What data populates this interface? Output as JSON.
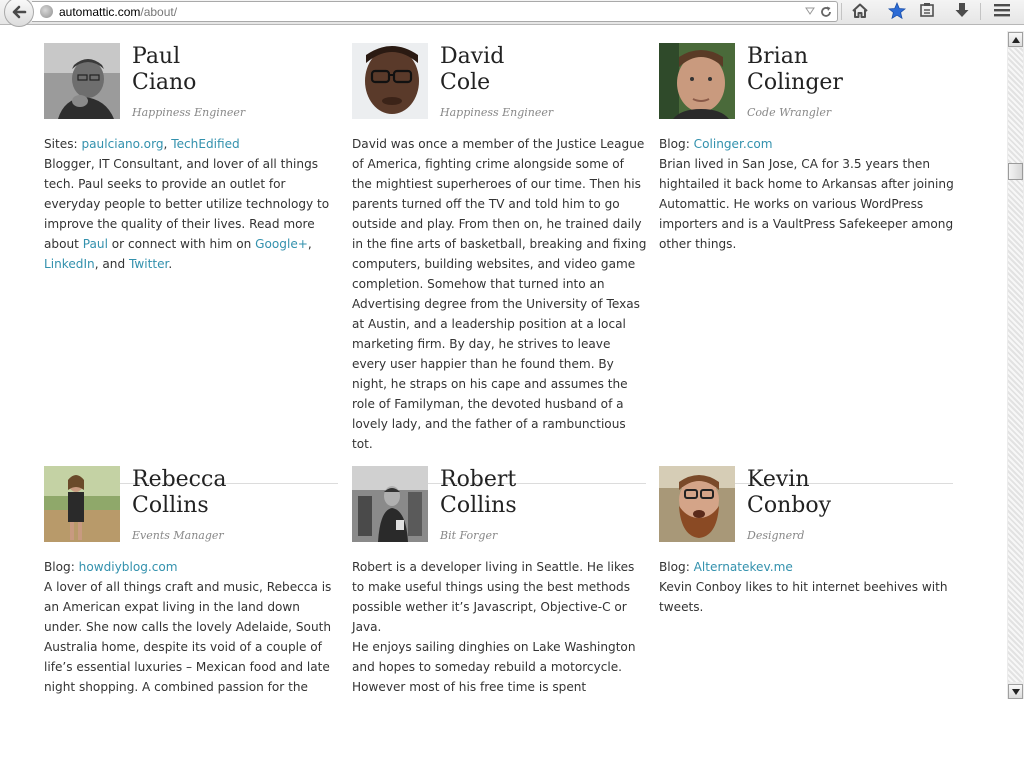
{
  "browser": {
    "url_domain": "automattic.com",
    "url_path": "/about/",
    "toolbar_icons": [
      "home-icon",
      "bookmark-star-icon",
      "clipboard-icon",
      "download-icon",
      "menu-icon"
    ]
  },
  "team": [
    {
      "first": "Paul",
      "last": "Ciano",
      "role": "Happiness Engineer",
      "links_label": "Sites: ",
      "links": [
        "paulciano.org",
        "TechEdified"
      ],
      "bio_pre": "Blogger, IT Consultant, and lover of all things tech. Paul seeks to provide an outlet for everyday people to better utilize technology to improve the quality of their lives. Read more about ",
      "bio_link1": "Paul",
      "bio_mid": " or connect with him on ",
      "bio_link2": "Google+",
      "bio_link3": "LinkedIn",
      "bio_and": ", and ",
      "bio_link4": "Twitter"
    },
    {
      "first": "David",
      "last": "Cole",
      "role": "Happiness Engineer",
      "bio": "David was once a member of the Justice League of America, fighting crime alongside some of the mightiest superheroes of our time. Then his parents turned off the TV and told him to go outside and play. From then on, he trained daily in the fine arts of basketball, breaking and fixing computers, building websites, and video game completion. Somehow that turned into an Advertising degree from the University of Texas at Austin, and a leadership position at a local marketing firm. By day, he strives to leave every user happier than he found them. By night, he straps on his cape and assumes the role of Familyman, the devoted husband of a lovely lady, and the father of a rambunctious tot."
    },
    {
      "first": "Brian",
      "last": "Colinger",
      "role": "Code Wrangler",
      "links_label": "Blog: ",
      "link": "Colinger.com",
      "bio": "Brian lived in San Jose, CA for 3.5 years then hightailed it back home to Arkansas after joining Automattic. He works on various WordPress importers and is a VaultPress Safekeeper among other things."
    },
    {
      "first": "Rebecca",
      "last": "Collins",
      "role": "Events Manager",
      "links_label": "Blog: ",
      "link": "howdiyblog.com",
      "bio": "A lover of all things craft and music, Rebecca is an American expat living in the land down under. She now calls the lovely Adelaide, South Australia home, despite its void of a couple of life’s essential luxuries – Mexican food and late night shopping. A combined passion for the"
    },
    {
      "first": "Robert",
      "last": "Collins",
      "role": "Bit Forger",
      "bio": "Robert is a developer living in Seattle. He likes to make useful things using the best methods possible wether it’s Javascript, Objective-C or Java.",
      "bio2": "He enjoys sailing dinghies on Lake Washington and hopes to someday rebuild a motorcycle. However most of his free time is spent"
    },
    {
      "first": "Kevin",
      "last": "Conboy",
      "role": "Designerd",
      "links_label": "Blog: ",
      "link": "Alternatekev.me",
      "bio": "Kevin Conboy likes to hit internet beehives with tweets."
    }
  ]
}
